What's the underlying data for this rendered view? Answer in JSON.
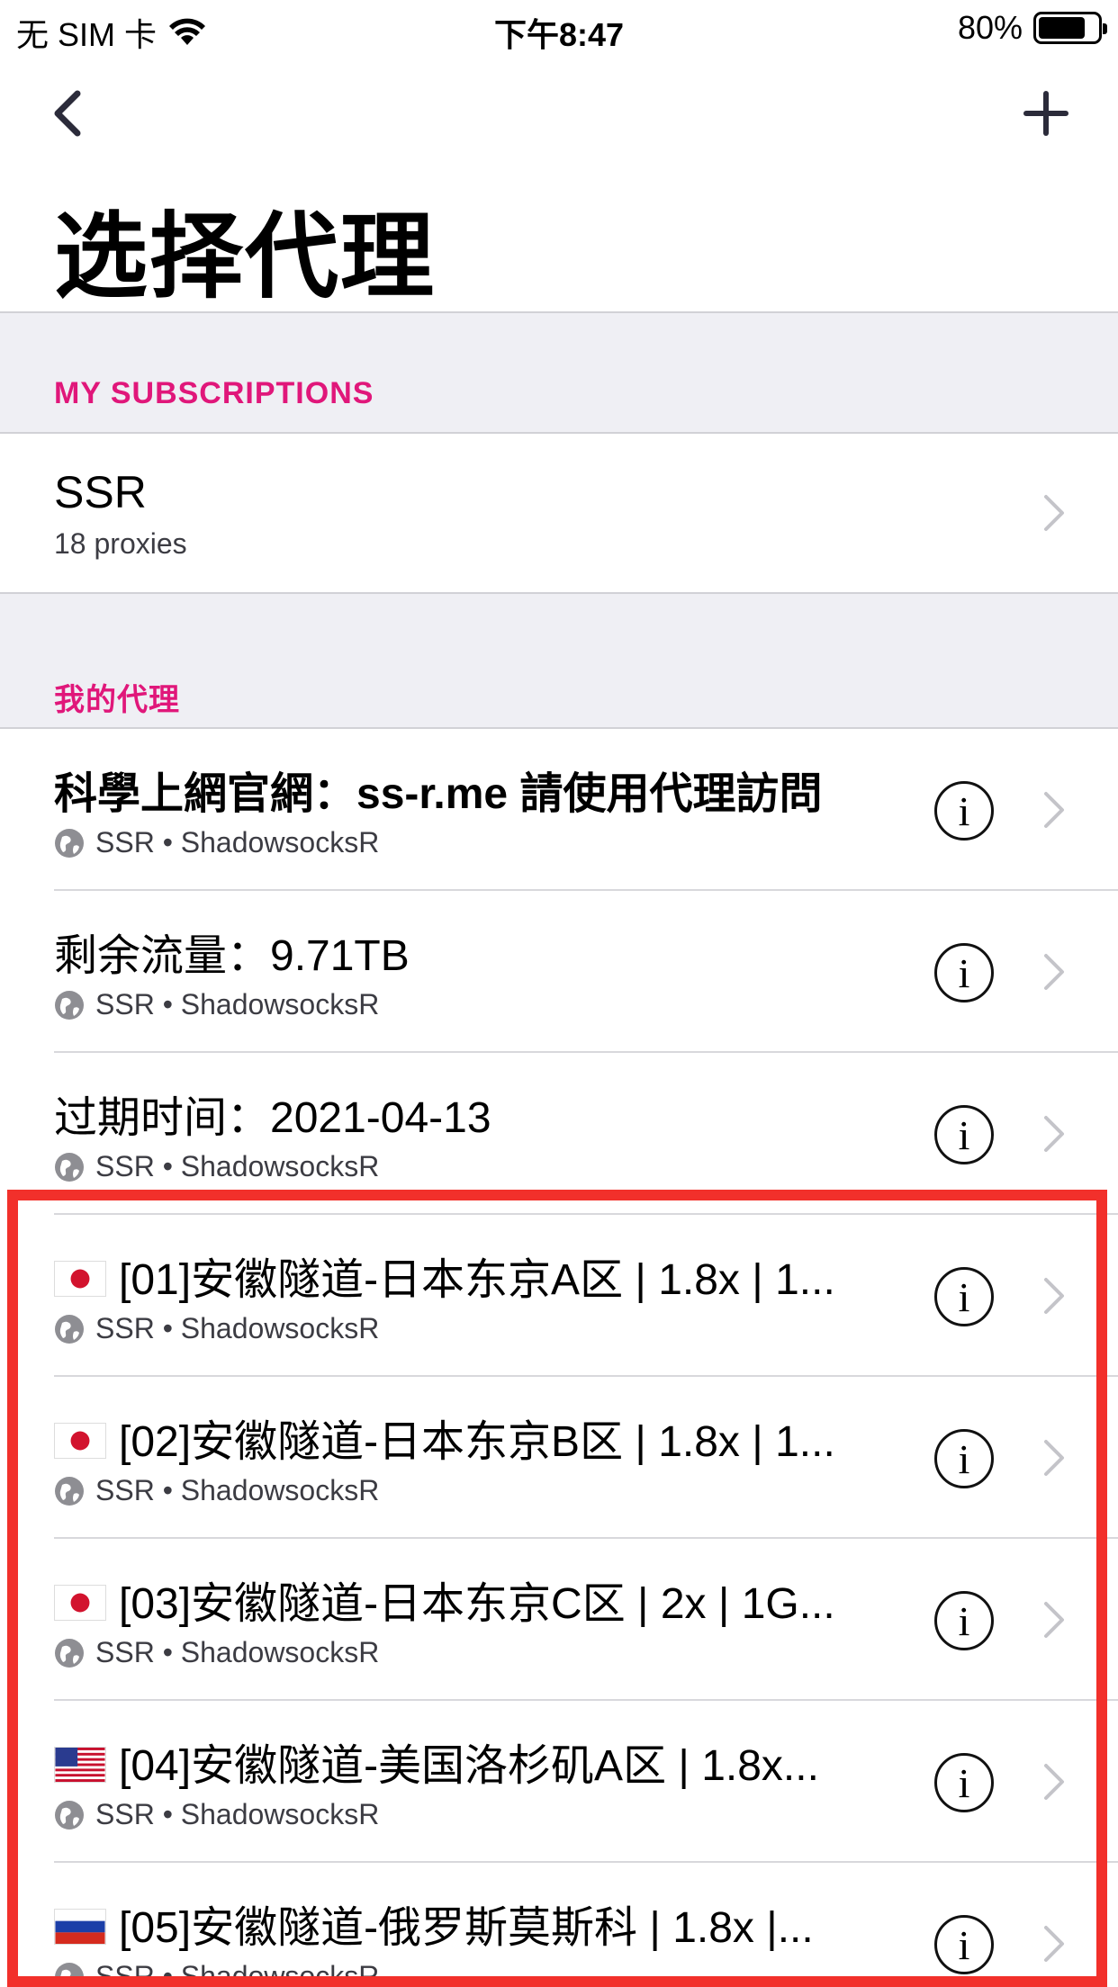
{
  "status_bar": {
    "carrier": "无 SIM 卡",
    "time": "下午8:47",
    "battery": "80%",
    "battery_level": 0.8
  },
  "nav": {
    "title": "选择代理"
  },
  "subscriptions": {
    "header": "MY SUBSCRIPTIONS",
    "item": {
      "name": "SSR",
      "count": "18 proxies"
    }
  },
  "proxies": {
    "header": "我的代理",
    "items": [
      {
        "title": "科學上網官網：ss-r.me 請使用代理訪問",
        "subtitle": "SSR • ShadowsocksR",
        "flag": ""
      },
      {
        "title": "剩余流量：9.71TB",
        "subtitle": "SSR • ShadowsocksR",
        "flag": ""
      },
      {
        "title": "过期时间：2021-04-13",
        "subtitle": "SSR • ShadowsocksR",
        "flag": ""
      },
      {
        "title": "[01]安徽隧道-日本东京A区 | 1.8x | 1...",
        "subtitle": "SSR • ShadowsocksR",
        "flag": "japan"
      },
      {
        "title": "[02]安徽隧道-日本东京B区 | 1.8x | 1...",
        "subtitle": "SSR • ShadowsocksR",
        "flag": "japan"
      },
      {
        "title": "[03]安徽隧道-日本东京C区 | 2x | 1G...",
        "subtitle": "SSR • ShadowsocksR",
        "flag": "japan"
      },
      {
        "title": "[04]安徽隧道-美国洛杉矶A区 | 1.8x...",
        "subtitle": "SSR • ShadowsocksR",
        "flag": "usa"
      },
      {
        "title": "[05]安徽隧道-俄罗斯莫斯科 | 1.8x |...",
        "subtitle": "SSR • ShadowsocksR",
        "flag": "russia"
      }
    ]
  },
  "colors": {
    "accent": "#e0177a",
    "highlight_border": "#f2302b",
    "section_bg": "#efeff4"
  }
}
